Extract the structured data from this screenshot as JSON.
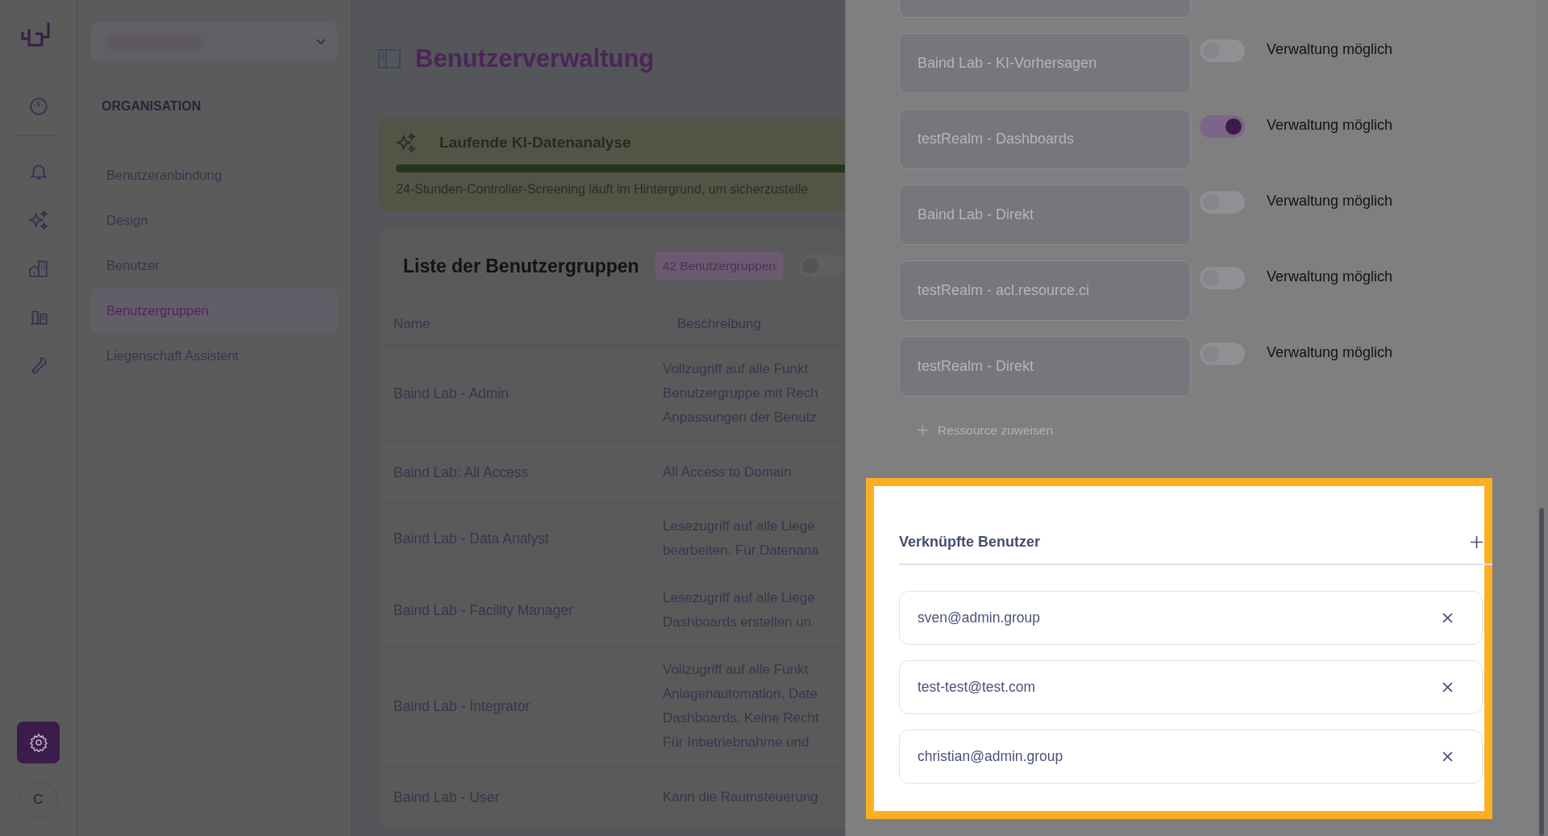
{
  "rail": {
    "items": [
      {
        "selected": false
      },
      {
        "selected": false
      },
      {
        "selected": false
      },
      {
        "selected": false
      },
      {
        "selected": false
      },
      {
        "selected": false
      }
    ],
    "settings": {
      "selected": true
    },
    "avatar": "C"
  },
  "sidebar": {
    "section": "ORGANISATION",
    "items": [
      {
        "label": "Benutzeranbindung",
        "selected": false
      },
      {
        "label": "Design",
        "selected": false
      },
      {
        "label": "Benutzer",
        "selected": false
      },
      {
        "label": "Benutzergruppen",
        "selected": true
      },
      {
        "label": "Liegenschaft Assistent",
        "selected": false
      }
    ]
  },
  "page_title": "Benutzerverwaltung",
  "banner": {
    "title": "Laufende KI-Datenanalyse",
    "level": 1,
    "text": "24-Stunden-Controller-Screening läuft im Hintergrund, um sicherzustelle"
  },
  "card": {
    "title": "Liste der Benutzergruppen",
    "badge": "42 Benutzergruppen",
    "toggle_on": false,
    "columns": [
      "Name",
      "Beschreibung"
    ],
    "rows": [
      {
        "name": "Baind Lab - Admin",
        "description": [
          "Vollzugriff auf alle Funkt",
          "Benutzergruppe mit Rech",
          "Anpassungen der Benutz"
        ]
      },
      {
        "name": "Baind Lab: All Access",
        "description": [
          "All Access to Domain"
        ]
      },
      {
        "name": "Baind Lab - Data Analyst",
        "description": [
          "Lesezugriff auf alle Liege",
          "bearbeiten. Für Datenana"
        ]
      },
      {
        "name": "Baind Lab - Facility Manager",
        "description": [
          "Lesezugriff auf alle Liege",
          "Dashboards erstellen un"
        ]
      },
      {
        "name": "Baind Lab - Integrator",
        "description": [
          "Vollzugriff auf alle Funkt",
          "Anlagenautomation, Date",
          "Dashboards. Keine Recht",
          "Für Inbetriebnahme und"
        ]
      },
      {
        "name": "Baind Lab - User",
        "description": [
          "Kann die Raumsteuerung"
        ]
      }
    ]
  },
  "drawer": {
    "resources": [
      {
        "name": "Baind Lab - KI-Vorhersagen",
        "on": false,
        "label": "Verwaltung möglich"
      },
      {
        "name": "testRealm - Dashboards",
        "on": true,
        "label": "Verwaltung möglich"
      },
      {
        "name": "Baind Lab - Direkt",
        "on": false,
        "label": "Verwaltung möglich"
      },
      {
        "name": "testRealm - acl.resource.ci",
        "on": false,
        "label": "Verwaltung möglich"
      },
      {
        "name": "testRealm - Direkt",
        "on": false,
        "label": "Verwaltung möglich"
      }
    ],
    "assign_button": "Ressource zuweisen",
    "linked": {
      "title": "Verknüpfte Benutzer",
      "users": [
        "sven@admin.group",
        "test-test@test.com",
        "christian@admin.group"
      ]
    }
  }
}
